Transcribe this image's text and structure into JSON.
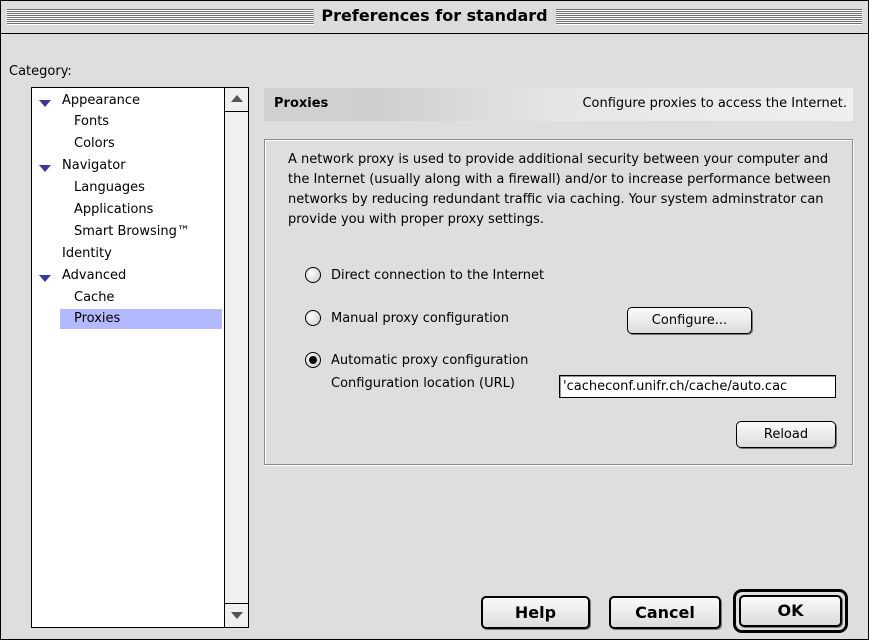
{
  "window": {
    "title": "Preferences for standard"
  },
  "sidebar": {
    "label": "Category:",
    "items": [
      {
        "label": "Appearance",
        "expanded": true
      },
      {
        "label": "Fonts"
      },
      {
        "label": "Colors"
      },
      {
        "label": "Navigator",
        "expanded": true
      },
      {
        "label": "Languages"
      },
      {
        "label": "Applications"
      },
      {
        "label": "Smart Browsing™"
      },
      {
        "label": "Identity"
      },
      {
        "label": "Advanced",
        "expanded": true
      },
      {
        "label": "Cache"
      },
      {
        "label": "Proxies",
        "selected": true
      }
    ]
  },
  "panel": {
    "title": "Proxies",
    "subtitle": "Configure proxies to access the Internet.",
    "description": "A network proxy is used to provide additional security between your computer and the Internet (usually along with a firewall) and/or to increase performance between networks by reducing redundant traffic via caching. Your system adminstrator can provide you with proper proxy settings.",
    "options": [
      {
        "label": "Direct connection to the Internet",
        "checked": false
      },
      {
        "label": "Manual proxy configuration",
        "checked": false
      },
      {
        "label": "Automatic proxy configuration",
        "checked": true
      }
    ],
    "configure_button": "Configure...",
    "url_label": "Configuration location (URL)",
    "url_value": "'cacheconf.unifr.ch/cache/auto.cac",
    "reload_button": "Reload"
  },
  "footer": {
    "help_button": "Help",
    "cancel_button": "Cancel",
    "ok_button": "OK"
  },
  "colors": {
    "selection": "#b3b9ff",
    "disclosure": "#3a3a9a"
  }
}
